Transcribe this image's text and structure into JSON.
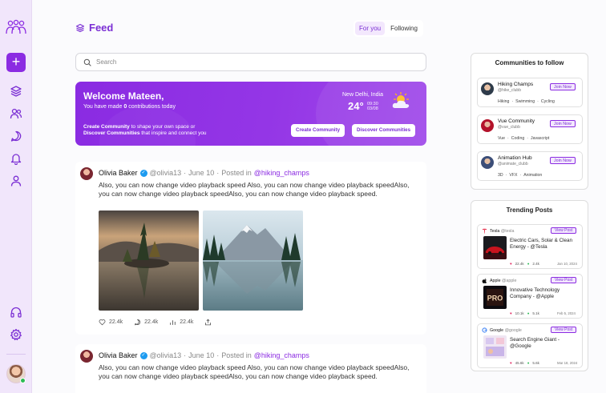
{
  "header": {
    "title": "Feed"
  },
  "tabs": [
    {
      "label": "For you",
      "active": true
    },
    {
      "label": "Following",
      "active": false
    }
  ],
  "search": {
    "placeholder": "Search"
  },
  "banner": {
    "welcome": "Welcome Mateen,",
    "contrib_prefix": "You have made ",
    "contrib_count": "0",
    "contrib_suffix": " contributions today",
    "line1_bold": "Create Community",
    "line1_rest": " to shape your own space or",
    "line2_bold": "Discover Communities",
    "line2_rest": " that inspire and connect you",
    "city": "New Delhi, India",
    "temperature": "24°",
    "time": "09:30",
    "date": "03/08",
    "create_label": "Create Community",
    "discover_label": "Discover Communities"
  },
  "posts": [
    {
      "author": "Olivia Baker",
      "handle": "@olivia13",
      "dot1": "·",
      "date": "June 10",
      "dot2": "·",
      "posted_in": "Posted in",
      "group": "@hiking_champs",
      "body": "Also, you can now change video playback speed Also, you can now change video playback speedAlso, you can now change video playback speedAlso, you can now change video playback speed.",
      "likes": "22.4k",
      "comments": "22.4k",
      "views": "22.4k"
    },
    {
      "author": "Olivia Baker",
      "handle": "@olivia13",
      "dot1": "·",
      "date": "June 10",
      "dot2": "·",
      "posted_in": "Posted in",
      "group": "@hiking_champs",
      "body": "Also, you can now change video playback speed Also, you can now change video playback speedAlso, you can now change video playback speedAlso, you can now change video playback speed."
    }
  ],
  "communities": {
    "title": "Communities to follow",
    "join_label": "Join Now",
    "items": [
      {
        "name": "Hiking Champs",
        "handle": "@hike_clubb",
        "tags": [
          "Hiking",
          "·",
          "Swimming",
          "·",
          "Cycling"
        ]
      },
      {
        "name": "Vue Community",
        "handle": "@vue_clubb",
        "tags": [
          "Vue",
          "·",
          "Coding",
          "·",
          "Javascript"
        ]
      },
      {
        "name": "Animation Hub",
        "handle": "@animate_clubb",
        "tags": [
          "3D",
          "·",
          "VFX",
          "·",
          "Animation"
        ]
      }
    ]
  },
  "trending": {
    "title": "Trending Posts",
    "view_label": "View Post",
    "items": [
      {
        "brand": "Tesla",
        "handle": "@tesla",
        "text": "Electric Cars, Solar & Clean Energy - @Tesla",
        "likes": "22.4k",
        "comments": "2.4k",
        "date": "Jan 10, 2024"
      },
      {
        "brand": "Apple",
        "handle": "@apple",
        "text": "Innovative Technology Company - @Apple",
        "likes": "10.1k",
        "comments": "5.1k",
        "date": "Feb 5, 2024"
      },
      {
        "brand": "Google",
        "handle": "@google",
        "text": "Search Engine Giant - @Google",
        "likes": "45.6k",
        "comments": "5.6k",
        "date": "Mar 18, 2024"
      }
    ]
  },
  "colors": {
    "accent": "#8b2be2",
    "banner": "#8a2be2",
    "rail": "#f1e6fb",
    "verified": "#1d9bf0",
    "online": "#2dbb55"
  }
}
